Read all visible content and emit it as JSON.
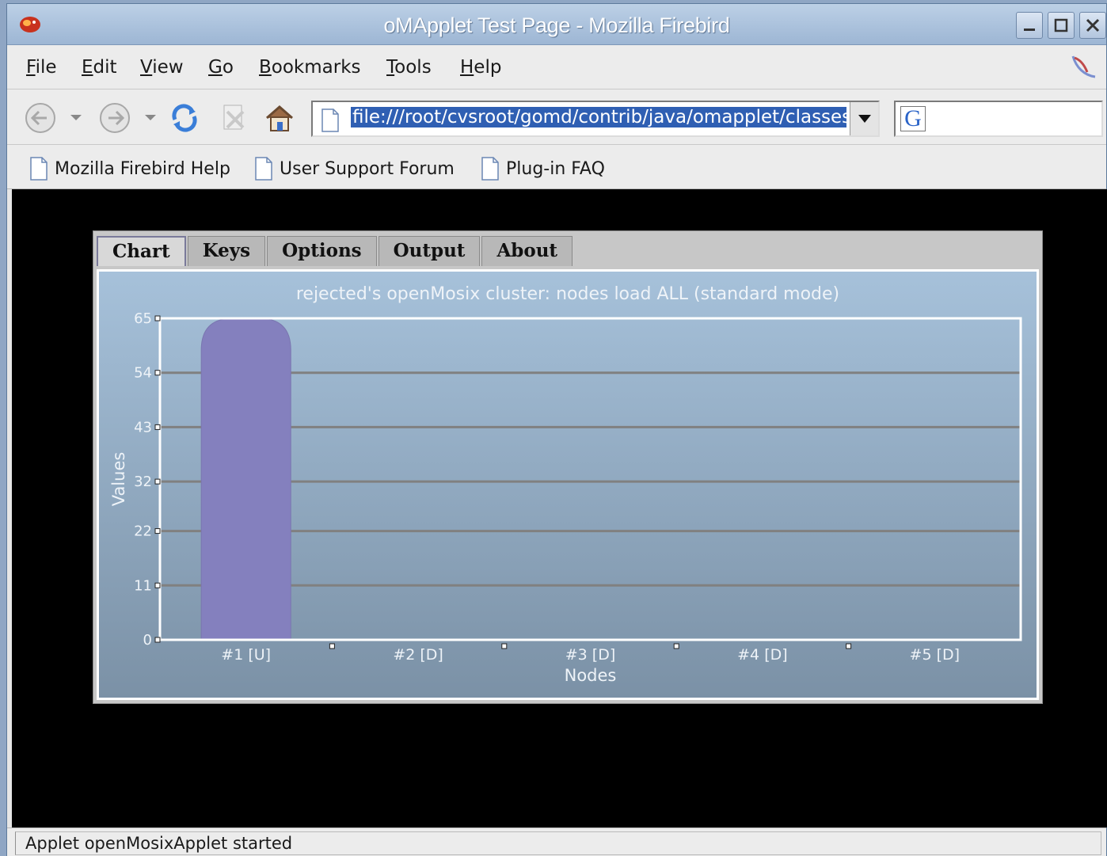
{
  "window": {
    "title": "oMApplet Test Page - Mozilla Firebird",
    "controls": [
      "minimize",
      "maximize",
      "close"
    ]
  },
  "menubar": {
    "items": [
      {
        "label": "File",
        "accel": "F",
        "rest": "ile"
      },
      {
        "label": "Edit",
        "accel": "E",
        "rest": "dit"
      },
      {
        "label": "View",
        "accel": "V",
        "rest": "iew"
      },
      {
        "label": "Go",
        "accel": "G",
        "rest": "o"
      },
      {
        "label": "Bookmarks",
        "accel": "B",
        "rest": "ookmarks"
      },
      {
        "label": "Tools",
        "accel": "T",
        "rest": "ools"
      },
      {
        "label": "Help",
        "accel": "H",
        "rest": "elp"
      }
    ]
  },
  "navbar": {
    "url": "file:///root/cvsroot/gomd/contrib/java/omapplet/classes/test.html",
    "search_value": ""
  },
  "bookmarks": {
    "items": [
      "Mozilla Firebird Help",
      "User Support Forum",
      "Plug-in FAQ"
    ]
  },
  "applet": {
    "tabs": [
      "Chart",
      "Keys",
      "Options",
      "Output",
      "About"
    ],
    "active_tab": "Chart"
  },
  "chart_data": {
    "type": "bar",
    "title": "rejected's openMosix cluster: nodes load ALL (standard mode)",
    "xlabel": "Nodes",
    "ylabel": "Values",
    "categories": [
      "#1 [U]",
      "#2 [D]",
      "#3 [D]",
      "#4 [D]",
      "#5 [D]"
    ],
    "values": [
      65,
      0,
      0,
      0,
      0
    ],
    "yticks": [
      0,
      11,
      22,
      32,
      43,
      54,
      65
    ],
    "ylim": [
      0,
      65
    ],
    "grid": true,
    "colors": {
      "bar": "#8480be",
      "grid": "#808080",
      "plot_border": "#ffffff",
      "text": "#eef3f8"
    }
  },
  "statusbar": {
    "text": "Applet openMosixApplet started"
  }
}
